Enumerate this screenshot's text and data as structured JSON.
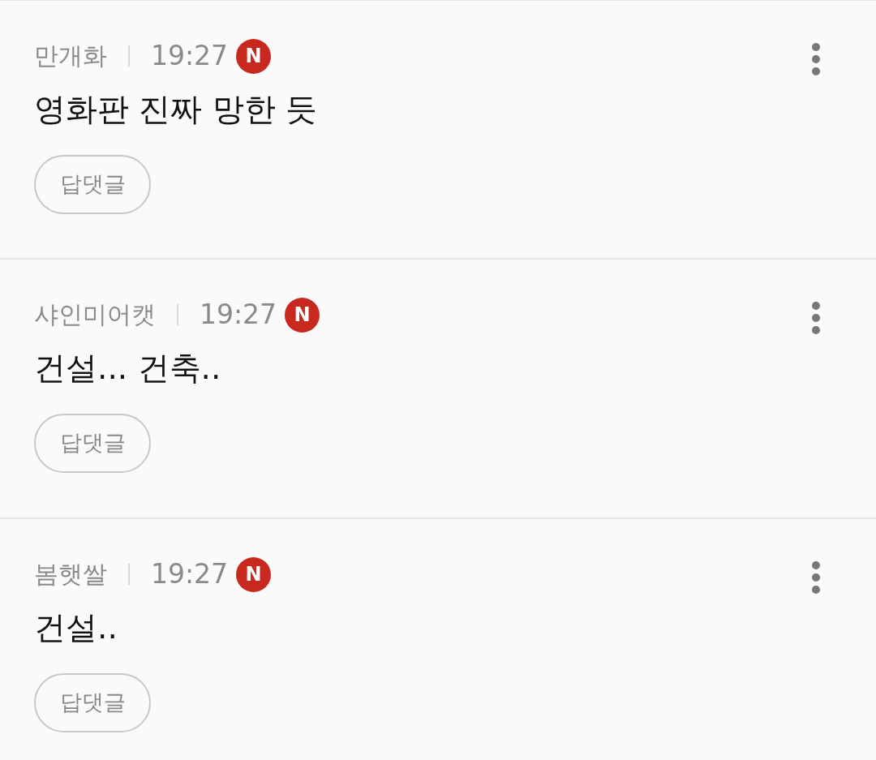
{
  "comments": [
    {
      "author": "만개화",
      "time": "19:27",
      "badge": "N",
      "text": "영화판 진짜 망한 듯",
      "reply_button": "답댓글"
    },
    {
      "author": "샤인미어캣",
      "time": "19:27",
      "badge": "N",
      "text": "건설... 건축..",
      "reply_button": "답댓글"
    },
    {
      "author": "봄햇쌀",
      "time": "19:27",
      "badge": "N",
      "text": "건설..",
      "reply_button": "답댓글"
    }
  ]
}
